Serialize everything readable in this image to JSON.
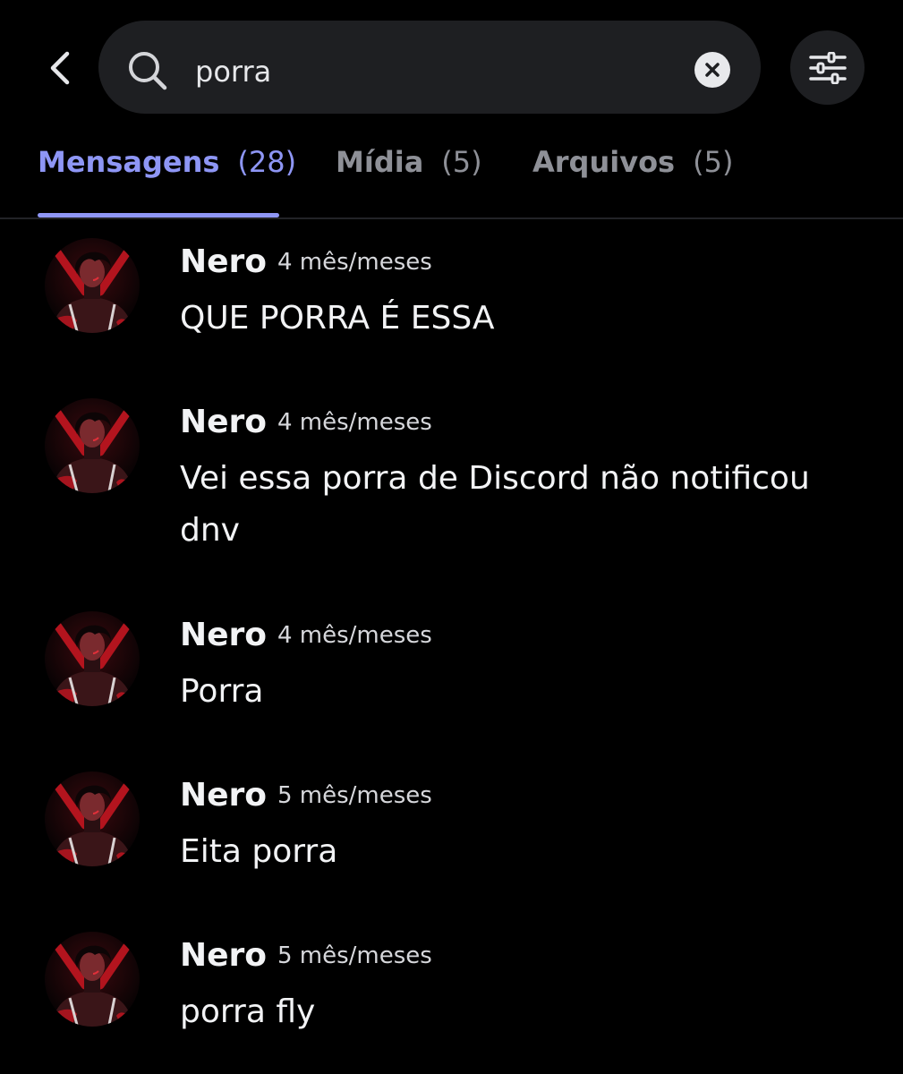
{
  "search": {
    "query": "porra"
  },
  "tabs": [
    {
      "label": "Mensagens",
      "count": "(28)"
    },
    {
      "label": "Mídia",
      "count": "(5)"
    },
    {
      "label": "Arquivos",
      "count": "(5)"
    }
  ],
  "results": [
    {
      "author": "Nero",
      "time": "4 mês/meses",
      "content": "QUE PORRA É ESSA"
    },
    {
      "author": "Nero",
      "time": "4 mês/meses",
      "content": "Vei essa porra de Discord não notificou dnv"
    },
    {
      "author": "Nero",
      "time": "4 mês/meses",
      "content": "Porra"
    },
    {
      "author": "Nero",
      "time": "5 mês/meses",
      "content": "Eita porra"
    },
    {
      "author": "Nero",
      "time": "5 mês/meses",
      "content": "porra fly"
    }
  ],
  "icons": {
    "back": "chevron-left-icon",
    "search": "search-icon",
    "clear": "close-circle-icon",
    "filter": "sliders-icon"
  },
  "colors": {
    "background": "#000000",
    "accent": "#8e96f5",
    "search_bg": "#1e1f22",
    "tab_inactive": "#8e9097"
  }
}
